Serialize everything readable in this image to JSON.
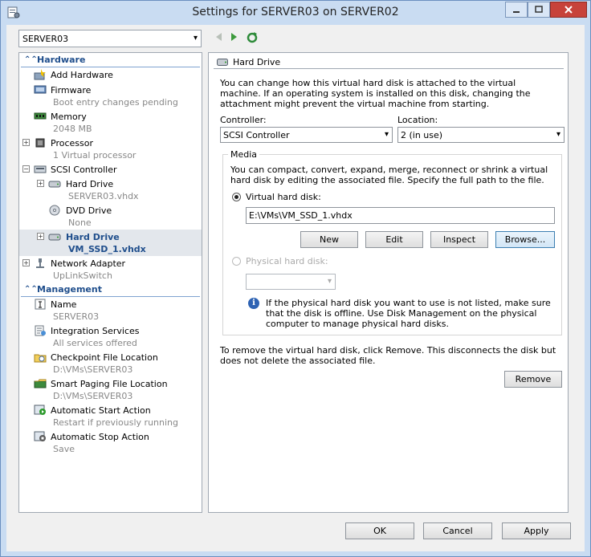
{
  "window": {
    "title": "Settings for SERVER03 on SERVER02",
    "colors": {
      "accent": "#1f4e8c",
      "titlebar": "#c9dcf2",
      "close": "#c7423a"
    }
  },
  "vm_selector": {
    "value": "SERVER03"
  },
  "sidebar": {
    "hardware_header": "Hardware",
    "management_header": "Management",
    "hardware_items": [
      {
        "label": "Add Hardware",
        "sub": "",
        "icon": "add-hardware-icon"
      },
      {
        "label": "Firmware",
        "sub": "Boot entry changes pending",
        "icon": "firmware-icon"
      },
      {
        "label": "Memory",
        "sub": "2048 MB",
        "icon": "memory-icon"
      },
      {
        "label": "Processor",
        "sub": "1 Virtual processor",
        "icon": "processor-icon"
      },
      {
        "label": "SCSI Controller",
        "sub": "",
        "icon": "scsi-controller-icon"
      },
      {
        "label": "Hard Drive",
        "sub": "SERVER03.vhdx",
        "icon": "hard-drive-icon"
      },
      {
        "label": "DVD Drive",
        "sub": "None",
        "icon": "dvd-drive-icon"
      },
      {
        "label": "Hard Drive",
        "sub": "VM_SSD_1.vhdx",
        "icon": "hard-drive-icon"
      },
      {
        "label": "Network Adapter",
        "sub": "UpLinkSwitch",
        "icon": "network-adapter-icon"
      }
    ],
    "management_items": [
      {
        "label": "Name",
        "sub": "SERVER03",
        "icon": "name-icon"
      },
      {
        "label": "Integration Services",
        "sub": "All services offered",
        "icon": "integration-services-icon"
      },
      {
        "label": "Checkpoint File Location",
        "sub": "D:\\VMs\\SERVER03",
        "icon": "checkpoint-icon"
      },
      {
        "label": "Smart Paging File Location",
        "sub": "D:\\VMs\\SERVER03",
        "icon": "smart-paging-icon"
      },
      {
        "label": "Automatic Start Action",
        "sub": "Restart if previously running",
        "icon": "auto-start-icon"
      },
      {
        "label": "Automatic Stop Action",
        "sub": "Save",
        "icon": "auto-stop-icon"
      }
    ]
  },
  "panel": {
    "header": "Hard Drive",
    "intro": "You can change how this virtual hard disk is attached to the virtual machine. If an operating system is installed on this disk, changing the attachment might prevent the virtual machine from starting.",
    "controller_label": "Controller:",
    "controller_value": "SCSI Controller",
    "location_label": "Location:",
    "location_value": "2 (in use)",
    "media_title": "Media",
    "media_desc": "You can compact, convert, expand, merge, reconnect or shrink a virtual hard disk by editing the associated file. Specify the full path to the file.",
    "vhd_label": "Virtual hard disk:",
    "vhd_path": "E:\\VMs\\VM_SSD_1.vhdx",
    "btn_new": "New",
    "btn_edit": "Edit",
    "btn_inspect": "Inspect",
    "btn_browse": "Browse...",
    "physical_label": "Physical hard disk:",
    "physical_value": "",
    "physical_note": "If the physical hard disk you want to use is not listed, make sure that the disk is offline. Use Disk Management on the physical computer to manage physical hard disks.",
    "remove_text": "To remove the virtual hard disk, click Remove. This disconnects the disk but does not delete the associated file.",
    "btn_remove": "Remove"
  },
  "footer": {
    "ok": "OK",
    "cancel": "Cancel",
    "apply": "Apply"
  }
}
